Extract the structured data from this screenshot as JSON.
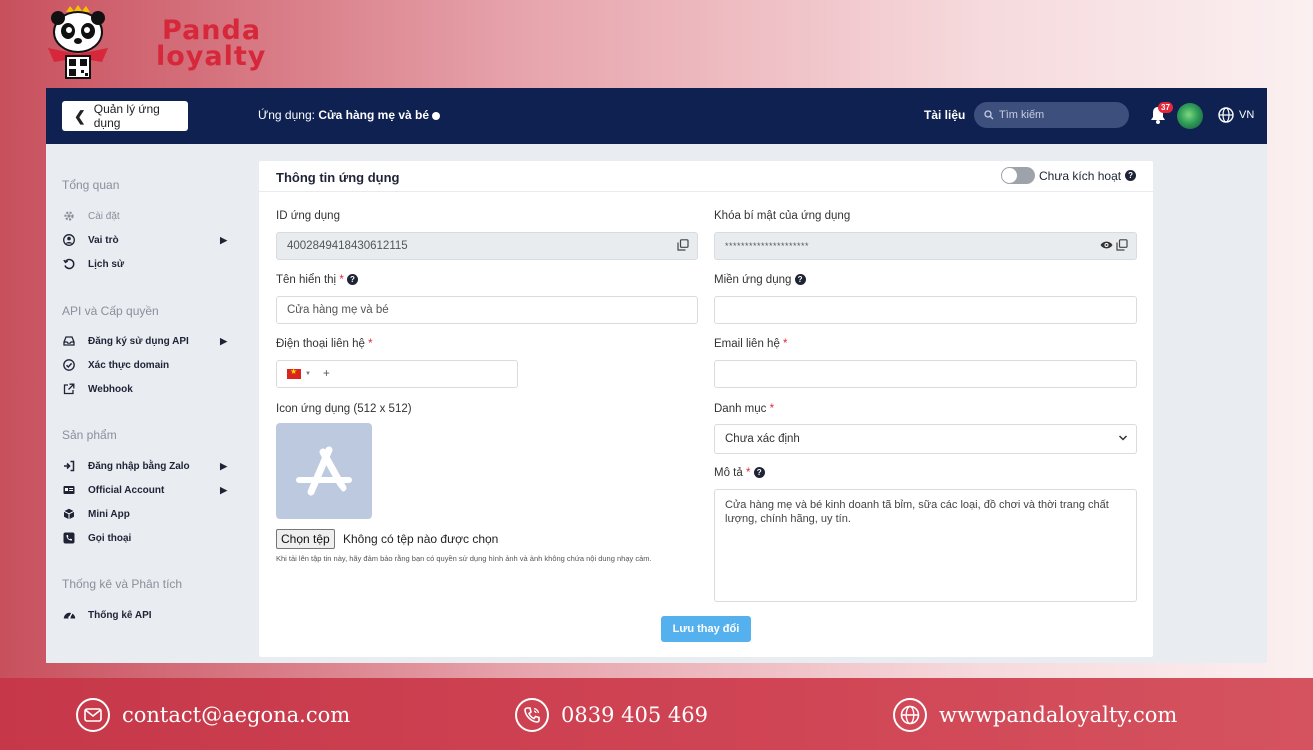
{
  "brand": {
    "logo_line1": "Panda",
    "logo_line2": "loyalty"
  },
  "topbar": {
    "back_label": "Quản lý ứng dụng",
    "app_prefix": "Ứng dụng:",
    "app_name": "Cửa hàng mẹ và bé",
    "docs_label": "Tài liệu",
    "search_placeholder": "Tìm kiếm",
    "notification_count": "37",
    "language": "VN"
  },
  "sidebar": {
    "sections": [
      {
        "title": "Tổng quan",
        "items": [
          {
            "label": "Cài đặt",
            "icon": "gear-icon",
            "arrow": false,
            "muted": true
          },
          {
            "label": "Vai trò",
            "icon": "user-circle-icon",
            "arrow": true
          },
          {
            "label": "Lịch sử",
            "icon": "history-icon",
            "arrow": false
          }
        ]
      },
      {
        "title": "API và Cấp quyền",
        "items": [
          {
            "label": "Đăng ký sử dụng API",
            "icon": "inbox-icon",
            "arrow": true
          },
          {
            "label": "Xác thực domain",
            "icon": "check-circle-icon",
            "arrow": false
          },
          {
            "label": "Webhook",
            "icon": "external-link-icon",
            "arrow": false
          }
        ]
      },
      {
        "title": "Sản phẩm",
        "items": [
          {
            "label": "Đăng nhập bằng Zalo",
            "icon": "sign-in-icon",
            "arrow": true
          },
          {
            "label": "Official Account",
            "icon": "id-card-icon",
            "arrow": true
          },
          {
            "label": "Mini App",
            "icon": "cube-icon",
            "arrow": false
          },
          {
            "label": "Gọi thoại",
            "icon": "phone-square-icon",
            "arrow": false
          }
        ]
      },
      {
        "title": "Thống kê và Phân tích",
        "items": [
          {
            "label": "Thống kê API",
            "icon": "tachometer-icon",
            "arrow": false
          }
        ]
      }
    ]
  },
  "card": {
    "title": "Thông tin ứng dụng",
    "status_label": "Chưa kích hoạt",
    "app_id_label": "ID ứng dụng",
    "app_id_value": "4002849418430612115",
    "secret_label": "Khóa bí mật của ứng dụng",
    "secret_value": "*********************",
    "display_name_label": "Tên hiển thị",
    "display_name_value": "Cửa hàng mẹ và bé",
    "domain_label": "Miền ứng dụng",
    "domain_value": "",
    "phone_label": "Điện thoại liên hệ",
    "phone_prefix": "+",
    "email_label": "Email liên hệ",
    "email_value": "",
    "icon_label": "Icon ứng dụng (512 x 512)",
    "category_label": "Danh mục",
    "category_value": "Chưa xác định",
    "description_label": "Mô tả",
    "description_value": "Cửa hàng mẹ và bé kinh doanh tã bỉm, sữa các loại, đồ chơi và thời trang chất lượng, chính hãng, uy tín.",
    "file_button": "Chọn tệp",
    "file_status": "Không có tệp nào được chọn",
    "file_hint": "Khi tải lên tập tin này, hãy đảm bảo rằng bạn có quyền sử dụng hình ảnh và ảnh không chứa nội dung nhạy cảm.",
    "save_label": "Lưu thay đổi",
    "required_mark": "*"
  },
  "footer": {
    "email": "contact@aegona.com",
    "phone": "0839 405 469",
    "website": "wwwpandaloyalty.com"
  },
  "colors": {
    "topbar": "#0e2151",
    "accent_button": "#55b1ee",
    "brand_red": "#d6283a",
    "footer": "#c63849"
  }
}
